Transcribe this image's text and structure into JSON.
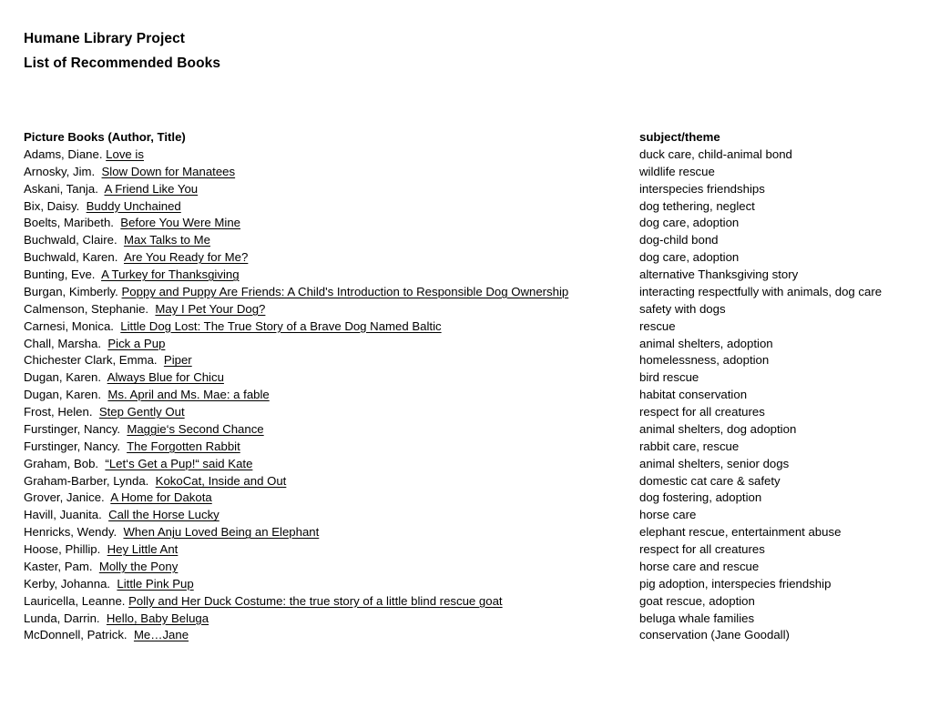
{
  "document": {
    "title_lines": [
      "Humane Library Project",
      "List of Recommended Books"
    ]
  },
  "table": {
    "headers": {
      "left": "Picture Books (Author, Title)",
      "right": "subject/theme"
    },
    "rows": [
      {
        "author": "Adams, Diane.",
        "sep": " ",
        "title": "Love is",
        "subject": "duck care, child-animal bond"
      },
      {
        "author": "Arnosky, Jim.",
        "sep": "  ",
        "title": "Slow Down for Manatees",
        "subject": "wildlife rescue"
      },
      {
        "author": "Askani, Tanja.",
        "sep": "  ",
        "title": "A Friend Like You",
        "subject": "interspecies friendships"
      },
      {
        "author": "Bix, Daisy.",
        "sep": "  ",
        "title": "Buddy Unchained",
        "subject": "dog tethering, neglect"
      },
      {
        "author": "Boelts, Maribeth.",
        "sep": "  ",
        "title": "Before You Were Mine",
        "subject": "dog care, adoption"
      },
      {
        "author": "Buchwald, Claire.",
        "sep": "  ",
        "title": "Max Talks to Me",
        "subject": "dog-child bond"
      },
      {
        "author": "Buchwald, Karen.",
        "sep": "  ",
        "title": "Are You Ready for Me?",
        "subject": "dog care, adoption"
      },
      {
        "author": "Bunting, Eve.",
        "sep": "  ",
        "title": "A Turkey for Thanksgiving",
        "subject": "alternative Thanksgiving story"
      },
      {
        "author": "Burgan, Kimberly.",
        "sep": " ",
        "title": "Poppy and Puppy Are Friends: A Child's Introduction to Responsible Dog Ownership",
        "subject": "interacting respectfully with animals, dog care"
      },
      {
        "author": "Calmenson, Stephanie.",
        "sep": "  ",
        "title": "May I Pet Your Dog?",
        "subject": "safety with dogs"
      },
      {
        "author": "Carnesi, Monica.",
        "sep": "  ",
        "title": "Little Dog Lost: The True Story of a Brave Dog Named Baltic",
        "subject": "rescue"
      },
      {
        "author": "Chall, Marsha.",
        "sep": "  ",
        "title": "Pick a Pup",
        "subject": "animal shelters, adoption"
      },
      {
        "author": "Chichester Clark, Emma.",
        "sep": "  ",
        "title": "Piper",
        "subject": "homelessness, adoption"
      },
      {
        "author": "Dugan, Karen.",
        "sep": "  ",
        "title": "Always Blue for Chicu",
        "subject": "bird rescue"
      },
      {
        "author": "Dugan, Karen.",
        "sep": "  ",
        "title": "Ms. April and Ms. Mae: a fable",
        "subject": "habitat conservation"
      },
      {
        "author": "Frost, Helen.",
        "sep": "  ",
        "title": "Step Gently Out",
        "subject": "respect for all creatures"
      },
      {
        "author": "Furstinger, Nancy.",
        "sep": "  ",
        "title": "Maggie‘s Second Chance",
        "subject": "animal shelters, dog adoption"
      },
      {
        "author": "Furstinger, Nancy.",
        "sep": "  ",
        "title": "The Forgotten Rabbit",
        "subject": "rabbit care, rescue"
      },
      {
        "author": "Graham, Bob.",
        "sep": "  ",
        "title": "“Let‘s Get a Pup!“ said Kate",
        "subject": "animal shelters, senior dogs"
      },
      {
        "author": "Graham-Barber, Lynda.",
        "sep": "  ",
        "title": "KokoCat, Inside and Out",
        "subject": "domestic cat care & safety"
      },
      {
        "author": "Grover, Janice.",
        "sep": "  ",
        "title": "A Home for Dakota",
        "subject": "dog fostering, adoption"
      },
      {
        "author": "Havill, Juanita.",
        "sep": "  ",
        "title": "Call the Horse Lucky",
        "subject": "horse care"
      },
      {
        "author": "Henricks, Wendy.",
        "sep": "  ",
        "title": "When Anju Loved Being an Elephant",
        "subject": "elephant rescue, entertainment abuse"
      },
      {
        "author": "Hoose, Phillip.",
        "sep": "  ",
        "title": "Hey Little Ant",
        "subject": "respect for all creatures"
      },
      {
        "author": "Kaster, Pam.",
        "sep": "  ",
        "title": "Molly the Pony",
        "subject": "horse care and rescue"
      },
      {
        "author": "Kerby, Johanna.",
        "sep": "  ",
        "title": "Little Pink Pup",
        "subject": "pig adoption, interspecies friendship"
      },
      {
        "author": "Lauricella, Leanne.",
        "sep": " ",
        "title": "Polly and Her Duck Costume: the true story of a little blind rescue goat",
        "subject": "goat rescue, adoption"
      },
      {
        "author": "Lunda, Darrin.",
        "sep": "  ",
        "title": "Hello, Baby Beluga",
        "subject": "beluga whale families"
      },
      {
        "author": "McDonnell, Patrick.",
        "sep": "  ",
        "title": "Me…Jane",
        "subject": "conservation (Jane Goodall)"
      }
    ]
  }
}
